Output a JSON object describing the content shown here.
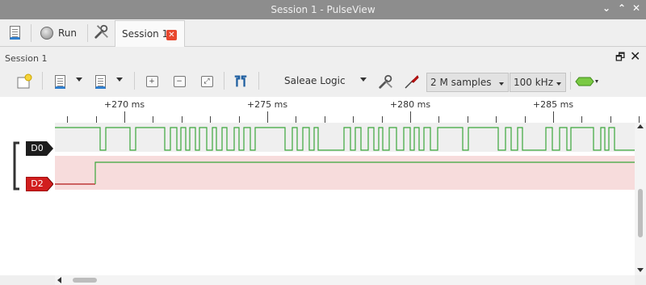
{
  "window": {
    "title": "Session 1 - PulseView",
    "controls": [
      "⌄",
      "⌃",
      "✕"
    ]
  },
  "main_toolbar": {
    "run_label": "Run",
    "tab_label": "Session 1",
    "tab_close": "✕"
  },
  "dock": {
    "title": "Session 1",
    "float_icon": "🗗",
    "close_icon": "✕"
  },
  "session_toolbar": {
    "device": "Saleae Logic",
    "samples": "2 M samples",
    "samplerate": "100 kHz"
  },
  "ruler": {
    "labels": [
      "+270 ms",
      "+275 ms",
      "+280 ms",
      "+285 ms"
    ]
  },
  "channels": [
    {
      "name": "D0",
      "color": "#1d1d1d",
      "bg": "#e6e6e6"
    },
    {
      "name": "D2",
      "color": "#d11e1e",
      "bg": "#f7dcdc"
    }
  ],
  "colors": {
    "trace_high": "#3aa63a",
    "trace_low": "#b31515",
    "titlebar": "#8d8d8d"
  }
}
